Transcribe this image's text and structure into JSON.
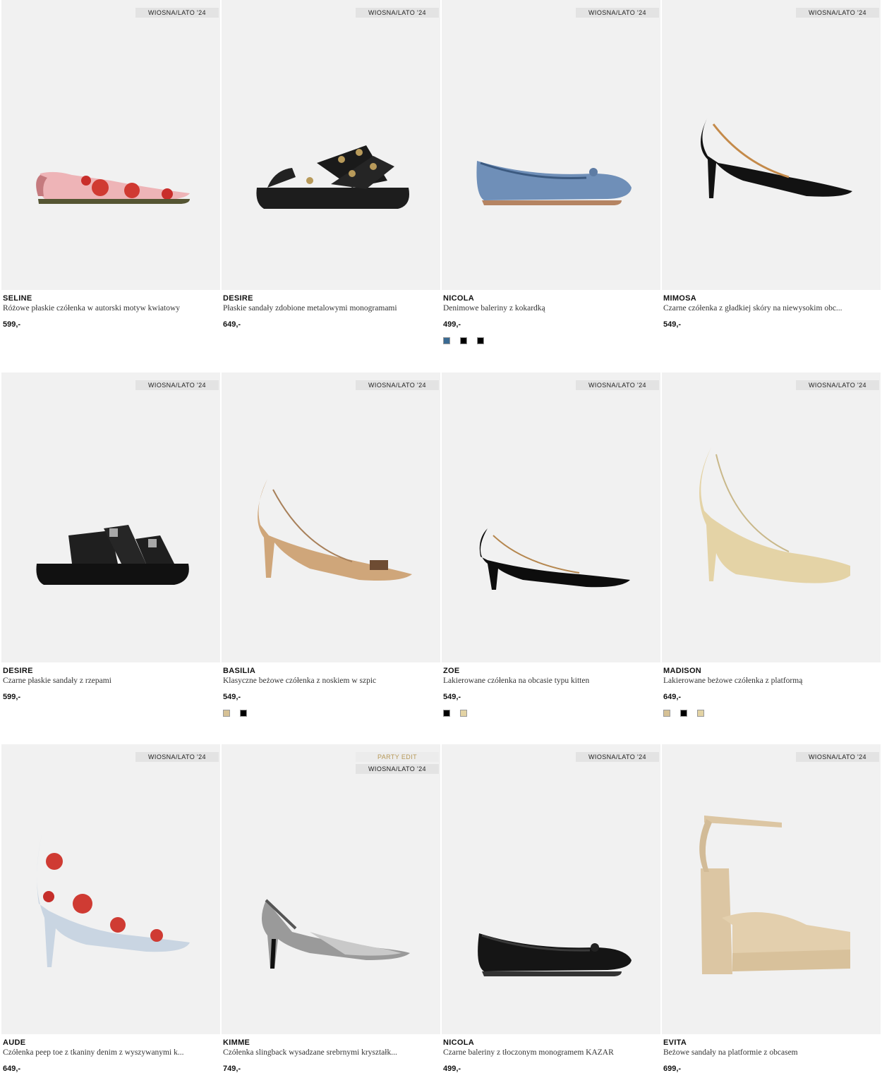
{
  "products": [
    {
      "brand": "SELINE",
      "desc": "Różowe płaskie czółenka w autorski motyw kwiatowy",
      "price": "599,-",
      "badges": [
        "WIOSNA/LATO '24"
      ],
      "icon": "floral-slingback-flat-icon",
      "swatches": []
    },
    {
      "brand": "DESIRE",
      "desc": "Płaskie sandały zdobione metalowymi monogramami",
      "price": "649,-",
      "badges": [
        "WIOSNA/LATO '24"
      ],
      "icon": "monogram-sandal-icon",
      "swatches": []
    },
    {
      "brand": "NICOLA",
      "desc": "Denimowe baleriny z kokardką",
      "price": "499,-",
      "badges": [
        "WIOSNA/LATO '24"
      ],
      "icon": "denim-ballerina-icon",
      "swatches": [
        "#3a6a92",
        "#000000",
        "#000000"
      ]
    },
    {
      "brand": "MIMOSA",
      "desc": "Czarne czółenka z gładkiej skóry na niewysokim obc...",
      "price": "549,-",
      "badges": [
        "WIOSNA/LATO '24"
      ],
      "icon": "black-pump-icon",
      "swatches": []
    },
    {
      "brand": "DESIRE",
      "desc": "Czarne płaskie sandały z rzepami",
      "price": "599,-",
      "badges": [
        "WIOSNA/LATO '24"
      ],
      "icon": "black-velcro-sandal-icon",
      "swatches": []
    },
    {
      "brand": "BASILIA",
      "desc": "Klasyczne beżowe czółenka z noskiem w szpic",
      "price": "549,-",
      "badges": [
        "WIOSNA/LATO '24"
      ],
      "icon": "beige-pump-icon",
      "swatches": [
        "#d6c195",
        "#000000"
      ]
    },
    {
      "brand": "ZOE",
      "desc": "Lakierowane czółenka na obcasie typu kitten",
      "price": "549,-",
      "badges": [
        "WIOSNA/LATO '24"
      ],
      "icon": "patent-kitten-heel-icon",
      "swatches": [
        "#000000",
        "#e3d3a4"
      ]
    },
    {
      "brand": "MADISON",
      "desc": "Lakierowane beżowe czółenka z platformą",
      "price": "649,-",
      "badges": [
        "WIOSNA/LATO '24"
      ],
      "icon": "platform-pump-icon",
      "swatches": [
        "#d6c195",
        "#000000",
        "#e3d3a4"
      ]
    },
    {
      "brand": "AUDE",
      "desc": "Czółenka peep toe z tkaniny denim z wyszywanymi k...",
      "price": "649,-",
      "badges": [
        "WIOSNA/LATO '24"
      ],
      "icon": "floral-peep-toe-icon",
      "swatches": []
    },
    {
      "brand": "KIMME",
      "desc": "Czółenka slingback wysadzane srebrnymi kryształk...",
      "price": "749,-",
      "badges": [
        "PARTY EDIT",
        "WIOSNA/LATO '24"
      ],
      "icon": "crystal-slingback-icon",
      "swatches": []
    },
    {
      "brand": "NICOLA",
      "desc": "Czarne baleriny z tłoczonym monogramem KAZAR",
      "price": "499,-",
      "badges": [
        "WIOSNA/LATO '24"
      ],
      "icon": "embossed-ballerina-icon",
      "swatches": []
    },
    {
      "brand": "EVITA",
      "desc": "Beżowe sandały na platformie z obcasem",
      "price": "699,-",
      "badges": [
        "WIOSNA/LATO '24"
      ],
      "icon": "platform-block-heel-sandal-icon",
      "swatches": []
    }
  ]
}
